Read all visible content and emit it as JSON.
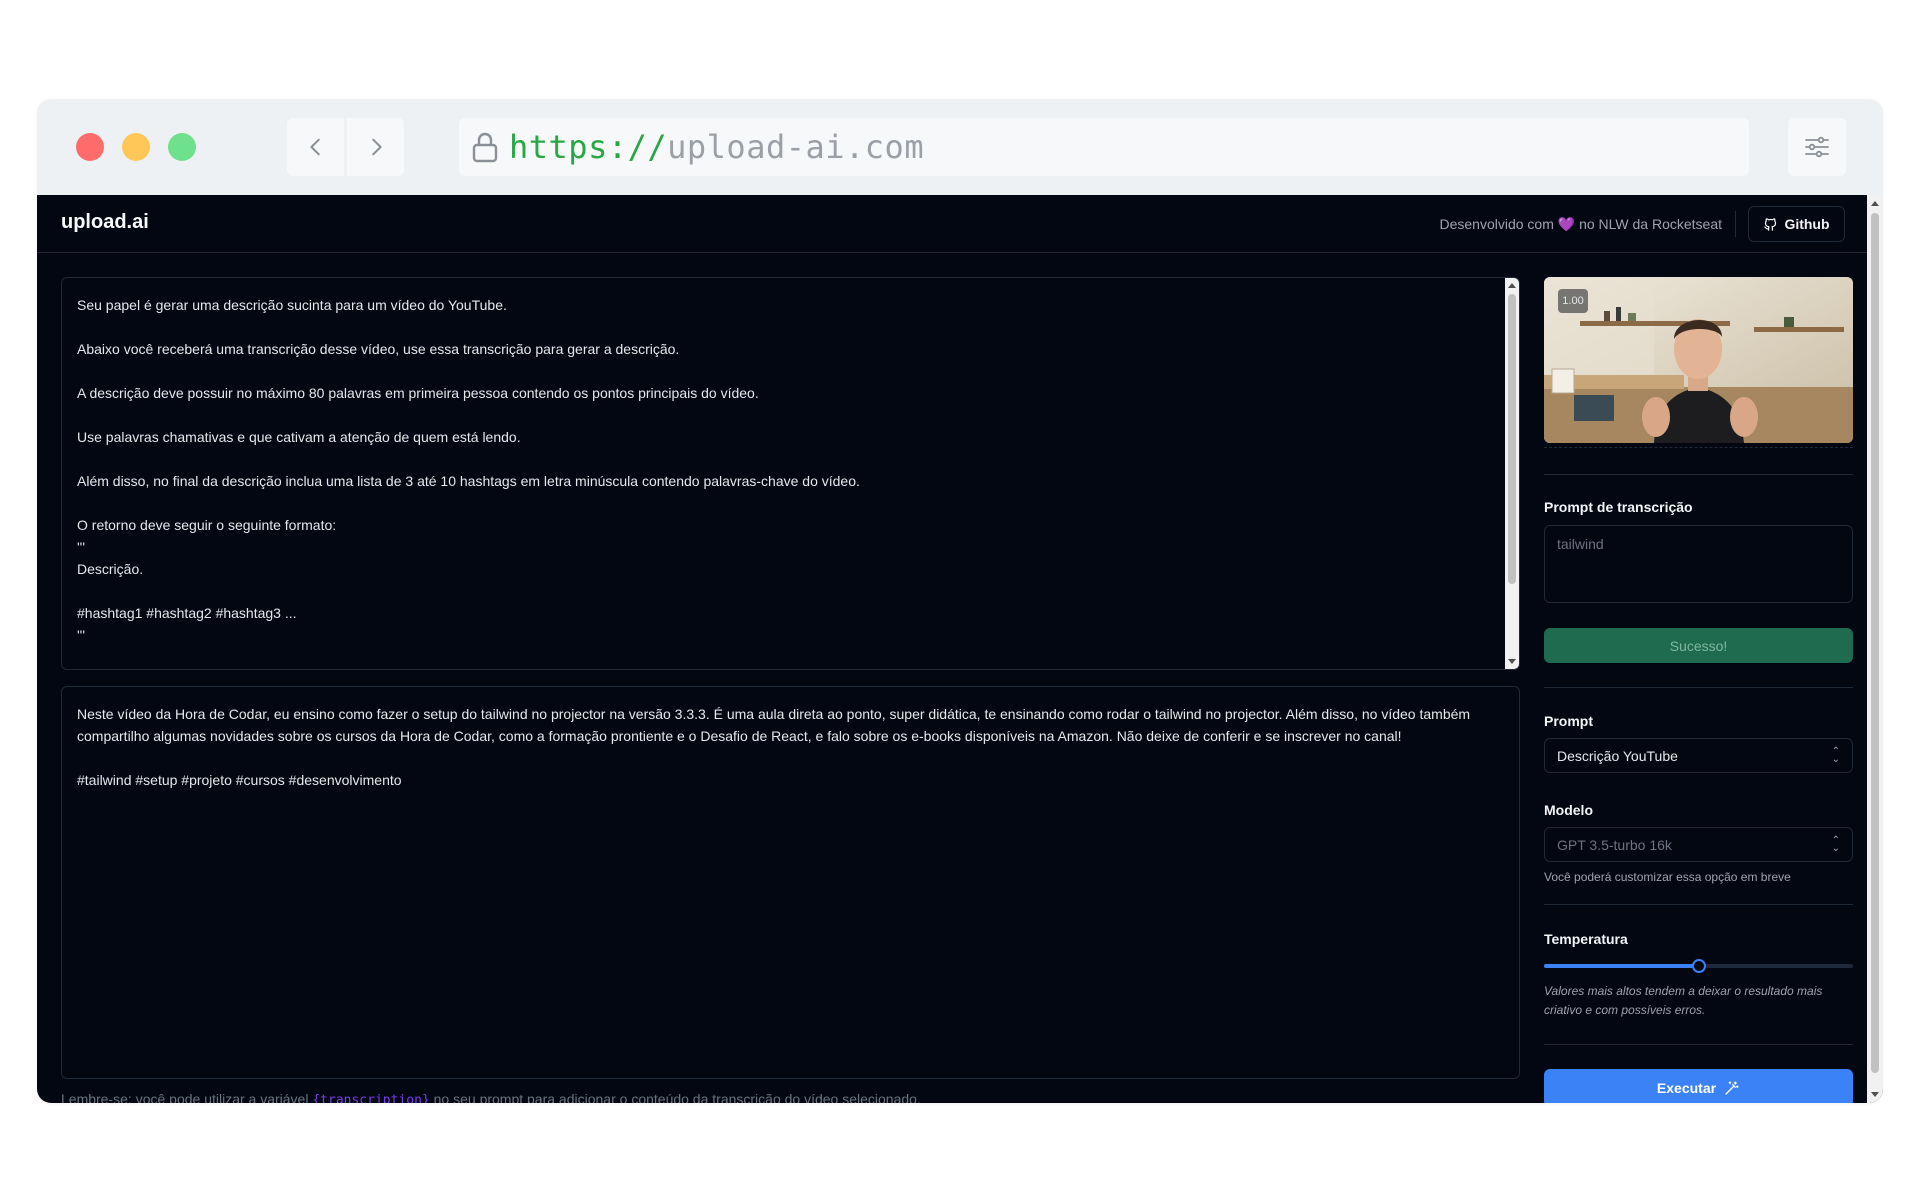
{
  "browser": {
    "url_protocol": "https://",
    "url_host": "upload-ai.com"
  },
  "header": {
    "brand": "upload.ai",
    "credit_prefix": "Desenvolvido com",
    "credit_heart": "💜",
    "credit_suffix": "no NLW da Rocketseat",
    "github_label": "Github"
  },
  "prompt_text": [
    "Seu papel é gerar uma descrição sucinta para um vídeo do YouTube.",
    "",
    "Abaixo você receberá uma transcrição desse vídeo, use essa transcrição para gerar a descrição.",
    "",
    "A descrição deve possuir no máximo 80 palavras em primeira pessoa contendo os pontos principais do vídeo.",
    "",
    "Use palavras chamativas e que cativam a atenção de quem está lendo.",
    "",
    "Além disso, no final da descrição inclua uma lista de 3 até 10 hashtags em letra minúscula contendo palavras-chave do vídeo.",
    "",
    "O retorno deve seguir o seguinte formato:",
    "'''",
    "Descrição.",
    "",
    "#hashtag1 #hashtag2 #hashtag3 ...",
    "'''"
  ],
  "result_text": [
    "Neste vídeo da Hora de Codar, eu ensino como fazer o setup do tailwind no projector na versão 3.3.3. É uma aula direta ao ponto, super didática, te ensinando como rodar o tailwind no projector. Além disso, no vídeo também compartilho algumas novidades sobre os cursos da Hora de Codar, como a formação prontiente e o Desafio de React, e falo sobre os e-books disponíveis na Amazon. Não deixe de conferir e se inscrever no canal!",
    "",
    "#tailwind #setup #projeto #cursos #desenvolvimento"
  ],
  "hint": {
    "before": "Lembre-se: você pode utilizar a variável ",
    "variable": "{transcription}",
    "after": " no seu prompt para adicionar o conteúdo da transcrição do vídeo selecionado."
  },
  "sidebar": {
    "video_speed": "1.00",
    "transcription_label": "Prompt de transcrição",
    "transcription_value": "tailwind",
    "success_label": "Sucesso!",
    "prompt_label": "Prompt",
    "prompt_selected": "Descrição YouTube",
    "model_label": "Modelo",
    "model_selected": "GPT 3.5-turbo 16k",
    "model_note": "Você poderá customizar essa opção em breve",
    "temperature_label": "Temperatura",
    "temperature_value": 0.5,
    "temperature_note": "Valores mais altos tendem a deixar o resultado mais criativo e com possíveis erros.",
    "run_label": "Executar"
  },
  "colors": {
    "background": "#030712",
    "border": "#1f2937",
    "accent": "#3b82f6",
    "success": "#1e6b4f",
    "variable": "#7c3aed"
  },
  "icons": [
    "lock-icon",
    "chevron-left-icon",
    "chevron-right-icon",
    "sliders-icon",
    "github-icon",
    "wand-icon"
  ]
}
